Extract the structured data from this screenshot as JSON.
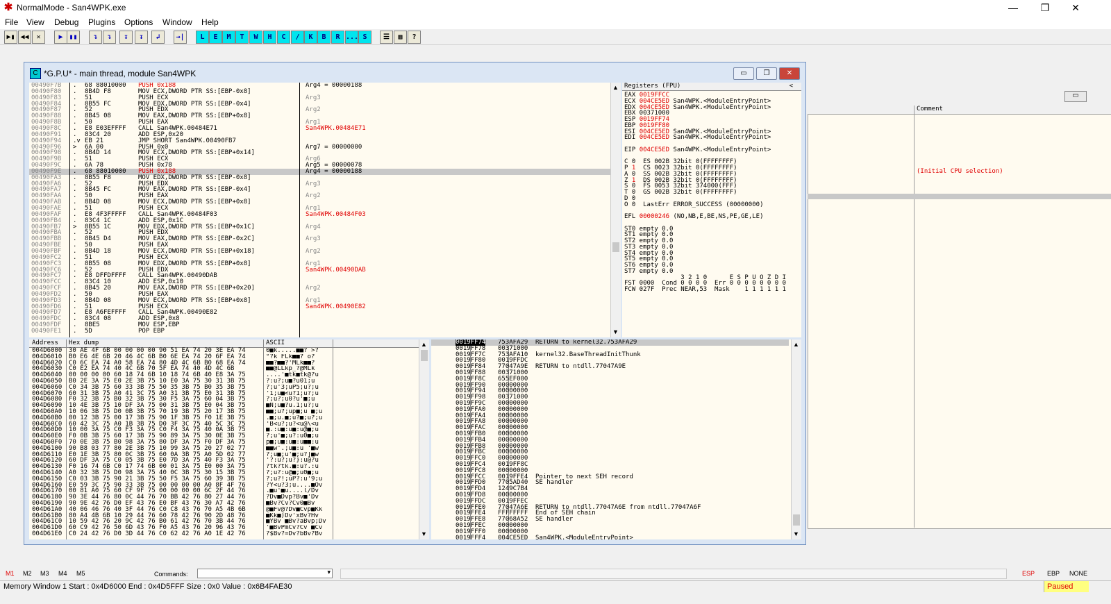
{
  "window": {
    "title": "NormalMode - San4WPK.exe"
  },
  "menu": [
    "File",
    "View",
    "Debug",
    "Plugins",
    "Options",
    "Window",
    "Help"
  ],
  "toolbar": {
    "buttons": [
      "▶▮",
      "◀◀",
      "✕",
      "▶",
      "▮▮",
      "↴",
      "↴",
      "↧",
      "↧",
      "↲",
      "→|",
      "L",
      "E",
      "M",
      "T",
      "W",
      "H",
      "C",
      "/",
      "K",
      "B",
      "R",
      "...",
      "S",
      "☰",
      "▦",
      "?"
    ]
  },
  "cpu": {
    "title": "*G.P.U* - main thread, module San4WPK",
    "icon_letter": "C",
    "disasm": [
      {
        "addr": "00490F7B",
        "dot": ".",
        "hex": "68 88010000",
        "asm": "PUSH 0x188",
        "red": true
      },
      {
        "addr": "00490F80",
        "dot": ".",
        "hex": "8B4D F8",
        "asm": "MOV ECX,DWORD PTR SS:[EBP-0x8]"
      },
      {
        "addr": "00490F83",
        "dot": ".",
        "hex": "51",
        "asm": "PUSH ECX"
      },
      {
        "addr": "00490F84",
        "dot": ".",
        "hex": "8B55 FC",
        "asm": "MOV EDX,DWORD PTR SS:[EBP-0x4]"
      },
      {
        "addr": "00490F87",
        "dot": ".",
        "hex": "52",
        "asm": "PUSH EDX"
      },
      {
        "addr": "00490F88",
        "dot": ".",
        "hex": "8B45 08",
        "asm": "MOV EAX,DWORD PTR SS:[EBP+0x8]"
      },
      {
        "addr": "00490F8B",
        "dot": ".",
        "hex": "50",
        "asm": "PUSH EAX"
      },
      {
        "addr": "00490F8C",
        "dot": ".",
        "hex": "E8 E03EFFFF",
        "asm": "CALL San4WPK.00484E71"
      },
      {
        "addr": "00490F91",
        "dot": ".",
        "hex": "83C4 20",
        "asm": "ADD ESP,0x20"
      },
      {
        "addr": "00490F94",
        "dot": ".v",
        "hex": "EB 21",
        "asm": "JMP SHORT San4WPK.00490FB7"
      },
      {
        "addr": "00490F96",
        "dot": ">",
        "hex": "6A 00",
        "asm": "PUSH 0x0"
      },
      {
        "addr": "00490F98",
        "dot": ".",
        "hex": "8B4D 14",
        "asm": "MOV ECX,DWORD PTR SS:[EBP+0x14]"
      },
      {
        "addr": "00490F9B",
        "dot": ".",
        "hex": "51",
        "asm": "PUSH ECX"
      },
      {
        "addr": "00490F9C",
        "dot": ".",
        "hex": "6A 78",
        "asm": "PUSH 0x78"
      },
      {
        "addr": "00490F9E",
        "dot": ".",
        "hex": "68 88010000",
        "asm": "PUSH 0x188",
        "red": true,
        "sel": true
      },
      {
        "addr": "00490FA3",
        "dot": ".",
        "hex": "8B55 F8",
        "asm": "MOV EDX,DWORD PTR SS:[EBP-0x8]"
      },
      {
        "addr": "00490FA6",
        "dot": ".",
        "hex": "52",
        "asm": "PUSH EDX"
      },
      {
        "addr": "00490FA7",
        "dot": ".",
        "hex": "8B45 FC",
        "asm": "MOV EAX,DWORD PTR SS:[EBP-0x4]"
      },
      {
        "addr": "00490FAA",
        "dot": ".",
        "hex": "50",
        "asm": "PUSH EAX"
      },
      {
        "addr": "00490FAB",
        "dot": ".",
        "hex": "8B4D 08",
        "asm": "MOV ECX,DWORD PTR SS:[EBP+0x8]"
      },
      {
        "addr": "00490FAE",
        "dot": ".",
        "hex": "51",
        "asm": "PUSH ECX"
      },
      {
        "addr": "00490FAF",
        "dot": ".",
        "hex": "E8 4F3FFFFF",
        "asm": "CALL San4WPK.00484F03"
      },
      {
        "addr": "00490FB4",
        "dot": ".",
        "hex": "83C4 1C",
        "asm": "ADD ESP,0x1C"
      },
      {
        "addr": "00490FB7",
        "dot": ">",
        "hex": "8B55 1C",
        "asm": "MOV EDX,DWORD PTR SS:[EBP+0x1C]"
      },
      {
        "addr": "00490FBA",
        "dot": ".",
        "hex": "52",
        "asm": "PUSH EDX"
      },
      {
        "addr": "00490FBB",
        "dot": ".",
        "hex": "8B45 D4",
        "asm": "MOV EAX,DWORD PTR SS:[EBP-0x2C]"
      },
      {
        "addr": "00490FBE",
        "dot": ".",
        "hex": "50",
        "asm": "PUSH EAX"
      },
      {
        "addr": "00490FBF",
        "dot": ".",
        "hex": "8B4D 18",
        "asm": "MOV ECX,DWORD PTR SS:[EBP+0x18]"
      },
      {
        "addr": "00490FC2",
        "dot": ".",
        "hex": "51",
        "asm": "PUSH ECX"
      },
      {
        "addr": "00490FC3",
        "dot": ".",
        "hex": "8B55 08",
        "asm": "MOV EDX,DWORD PTR SS:[EBP+0x8]"
      },
      {
        "addr": "00490FC6",
        "dot": ".",
        "hex": "52",
        "asm": "PUSH EDX"
      },
      {
        "addr": "00490FC7",
        "dot": ".",
        "hex": "E8 DFFDFFFF",
        "asm": "CALL San4WPK.00490DAB"
      },
      {
        "addr": "00490FCC",
        "dot": ".",
        "hex": "83C4 10",
        "asm": "ADD ESP,0x10"
      },
      {
        "addr": "00490FCF",
        "dot": ".",
        "hex": "8B45 20",
        "asm": "MOV EAX,DWORD PTR SS:[EBP+0x20]"
      },
      {
        "addr": "00490FD2",
        "dot": ".",
        "hex": "50",
        "asm": "PUSH EAX"
      },
      {
        "addr": "00490FD3",
        "dot": ".",
        "hex": "8B4D 08",
        "asm": "MOV ECX,DWORD PTR SS:[EBP+0x8]"
      },
      {
        "addr": "00490FD6",
        "dot": ".",
        "hex": "51",
        "asm": "PUSH ECX"
      },
      {
        "addr": "00490FD7",
        "dot": ".",
        "hex": "E8 A6FEFFFF",
        "asm": "CALL San4WPK.00490E82"
      },
      {
        "addr": "00490FDC",
        "dot": ".",
        "hex": "83C4 08",
        "asm": "ADD ESP,0x8"
      },
      {
        "addr": "00490FDF",
        "dot": ".",
        "hex": "8BE5",
        "asm": "MOV ESP,EBP"
      },
      {
        "addr": "00490FE1",
        "dot": ".",
        "hex": "5D",
        "asm": "POP EBP"
      }
    ],
    "comments": [
      "Arg4 = 00000188",
      "",
      "Arg3",
      "",
      "Arg2",
      "",
      "Arg1",
      "San4WPK.00484E71",
      "",
      "",
      "Arg7 = 00000000",
      "",
      "Arg6",
      "Arg5 = 00000078",
      "Arg4 = 00000188",
      "",
      "Arg3",
      "",
      "Arg2",
      "",
      "Arg1",
      "San4WPK.00484F03",
      "",
      "Arg4",
      "",
      "Arg3",
      "",
      "Arg2",
      "",
      "Arg1",
      "San4WPK.00490DAB",
      "",
      "",
      "Arg2",
      "",
      "Arg1",
      "San4WPK.00490E82",
      "",
      "",
      "",
      ""
    ],
    "registers": {
      "header": "Registers (FPU)",
      "lines": [
        {
          "t": "EAX ",
          "v": "0019FFCC",
          "c": ""
        },
        {
          "t": "ECX ",
          "v": "004CE5ED",
          "c": " San4WPK.<ModuleEntryPoint>"
        },
        {
          "t": "EDX ",
          "v": "004CE5ED",
          "c": " San4WPK.<ModuleEntryPoint>"
        },
        {
          "t": "EBX 00371000",
          "v": "",
          "c": ""
        },
        {
          "t": "ESP ",
          "v": "0019FF74",
          "c": ""
        },
        {
          "t": "EBP ",
          "v": "0019FF80",
          "c": ""
        },
        {
          "t": "ESI ",
          "v": "004CE5ED",
          "c": " San4WPK.<ModuleEntryPoint>"
        },
        {
          "t": "EDI ",
          "v": "004CE5ED",
          "c": " San4WPK.<ModuleEntryPoint>"
        },
        {
          "t": "",
          "v": "",
          "c": ""
        },
        {
          "t": "EIP ",
          "v": "004CE5ED",
          "c": " San4WPK.<ModuleEntryPoint>"
        },
        {
          "t": "",
          "v": "",
          "c": ""
        },
        {
          "t": "C 0  ES 002B 32bit 0(FFFFFFFF)",
          "v": "",
          "c": ""
        },
        {
          "t": "P ",
          "v": "1",
          "c": "  CS 0023 32bit 0(FFFFFFFF)"
        },
        {
          "t": "A 0  SS 002B 32bit 0(FFFFFFFF)",
          "v": "",
          "c": ""
        },
        {
          "t": "Z ",
          "v": "1",
          "c": "  DS 002B 32bit 0(FFFFFFFF)"
        },
        {
          "t": "S 0  FS 0053 32bit 374000(FFF)",
          "v": "",
          "c": ""
        },
        {
          "t": "T 0  GS 002B 32bit 0(FFFFFFFF)",
          "v": "",
          "c": ""
        },
        {
          "t": "D 0",
          "v": "",
          "c": ""
        },
        {
          "t": "O 0  LastErr ERROR_SUCCESS (00000000)",
          "v": "",
          "c": ""
        },
        {
          "t": "",
          "v": "",
          "c": ""
        },
        {
          "t": "EFL ",
          "v": "00000246",
          "c": " (NO,NB,E,BE,NS,PE,GE,LE)"
        },
        {
          "t": "",
          "v": "",
          "c": ""
        },
        {
          "t": "ST0 empty 0.0",
          "v": "",
          "c": ""
        },
        {
          "t": "ST1 empty 0.0",
          "v": "",
          "c": ""
        },
        {
          "t": "ST2 empty 0.0",
          "v": "",
          "c": ""
        },
        {
          "t": "ST3 empty 0.0",
          "v": "",
          "c": ""
        },
        {
          "t": "ST4 empty 0.0",
          "v": "",
          "c": ""
        },
        {
          "t": "ST5 empty 0.0",
          "v": "",
          "c": ""
        },
        {
          "t": "ST6 empty 0.0",
          "v": "",
          "c": ""
        },
        {
          "t": "ST7 empty 0.0",
          "v": "",
          "c": ""
        },
        {
          "t": "               3 2 1 0      E S P U O Z D I",
          "v": "",
          "c": ""
        },
        {
          "t": "FST 0000  Cond 0 0 0 0  Err 0 0 0 0 0 0 0 0",
          "v": "",
          "c": ""
        },
        {
          "t": "FCW 027F  Prec NEAR,53  Mask    1 1 1 1 1 1",
          "v": "",
          "c": ""
        }
      ]
    },
    "dump": {
      "col_address": "Address",
      "col_hex": "Hex dump",
      "col_ascii": "ASCII",
      "rows": [
        [
          "004D6000",
          "30 AE 4F 6B 00 00 00 00 90 51 EA 74 20 3E EA 74",
          "0■k.....■■? >?"
        ],
        [
          "004D6010",
          "B0 E6 4E 6B 20 46 4C 6B B0 6E EA 74 20 6F EA 74",
          "°?k FLk■■? o?"
        ],
        [
          "004D6020",
          "C0 6C EA 74 A0 58 EA 74 80 4D 4C 6B B0 68 EA 74",
          "■■?■■?'MLk■■?"
        ],
        [
          "004D6030",
          "C0 E2 EA 74 40 4C 6B 70 5F EA 74 40 4D 4C 6B",
          "■■@LLkp_?@MLk"
        ],
        [
          "004D6040",
          "00 00 00 00 60 18 74 6B 10 18 74 6B 40 E8 3A 75",
          "....'■tk■tk@?u"
        ],
        [
          "004D6050",
          "B0 2E 3A 75 E0 2E 3B 75 10 E0 3A 75 30 31 3B 75",
          "?:u?;u■?u01;u"
        ],
        [
          "004D6060",
          "C0 34 3B 75 60 33 3B 75 50 35 3B 75 B0 35 3B 75",
          "?;u'3;uP5;u?;u"
        ],
        [
          "004D6070",
          "60 31 3B 75 A0 41 3C 75 A0 31 3B 75 E0 31 3B 75",
          "'1;u■<u?1;u?;u"
        ],
        [
          "004D6080",
          "F0 32 3B 75 B0 32 3B 75 30 F5 3A 75 60 04 3B 75",
          "?;u?;u0?u'■;u"
        ],
        [
          "004D6090",
          "10 4E 3B 75 10 DF 3A 75 00 31 3B 75 E0 04 3B 75",
          "■N;u■?u.1;u?;u"
        ],
        [
          "004D60A0",
          "10 06 3B 75 D0 0B 3B 75 70 19 3B 75 20 17 3B 75",
          "■■;u?;up■;u ■;u"
        ],
        [
          "004D60B0",
          "00 12 3B 75 00 17 3B 75 90 1F 3B 75 F0 1E 3B 75",
          ".■;u.■;u?■;u?;u"
        ],
        [
          "004D60C0",
          "60 42 3C 75 A0 1B 3B 75 D0 3F 3C 75 40 5C 3C 75",
          "'B<u?;u?<u@\\<u"
        ],
        [
          "004D60D0",
          "10 00 3A 75 C0 F3 3A 75 C0 F4 3A 75 40 0A 3B 75",
          "■.:u■:u■:u@■;u"
        ],
        [
          "004D60E0",
          "F0 0B 3B 75 60 17 3B 75 90 89 3A 75 30 0E 3B 75",
          "?;u'■;u?:u0■;u"
        ],
        [
          "004D60F0",
          "70 0E 3B 75 B0 98 3A 75 80 DF 3A 75 F0 DF 3A 75",
          "p■;u■:u■:u■■:u"
        ],
        [
          "004D6100",
          "90 B8 03 77 80 2E 3B 75 10 99 3A 75 20 27 02 77",
          "■■w'.;u■:u '■w"
        ],
        [
          "004D6110",
          "E0 1E 3B 75 80 0C 3B 75 60 0A 3B 75 A0 5D 02 77",
          "?;u■;u'■;u?]■w"
        ],
        [
          "004D6120",
          "60 DF 3A 75 C0 05 3B 75 E0 7D 3A 75 40 F3 3A 75",
          "'?:u?;u?}:u@?u"
        ],
        [
          "004D6130",
          "F0 16 74 6B C0 17 74 6B 00 01 3A 75 E0 00 3A 75",
          "?tk?tk.■:u?.:u"
        ],
        [
          "004D6140",
          "A0 32 3B 75 D0 98 3A 75 40 0C 3B 75 30 15 3B 75",
          "?;u?:u@■;u0■;u"
        ],
        [
          "004D6150",
          "C0 03 3B 75 90 21 3B 75 50 F5 3A 75 60 39 3B 75",
          "?;u?!;uP?:u'9;u"
        ],
        [
          "004D6160",
          "E0 59 3C 75 90 33 3B 75 00 00 00 00 A0 8F 4F 76",
          "?Y<u?3;u....■Ov"
        ],
        [
          "004D6170",
          "00 81 A0 75 60 CF 9F 75 00 00 00 00 6C 2F 44 76",
          ".■u'■u....l/Dv"
        ],
        [
          "004D6180",
          "90 3E 44 76 80 0C 44 76 70 BB 42 76 80 27 44 76",
          "?Dv■Dvp?Bv■'Dv"
        ],
        [
          "004D6190",
          "90 9E 42 76 D0 EF 43 76 E0 BF 43 76 30 A7 42 76",
          "■Bv?Cv?Cv0■Bv"
        ],
        [
          "004D61A0",
          "40 06 46 76 40 3F 44 76 C0 C8 43 76 70 A5 4B 6B",
          "@■Fv@?Dv■Cvp■Kk"
        ],
        [
          "004D61B0",
          "80 A4 4B 6B 10 29 44 76 60 78 42 76 90 2D 48 76",
          "■Kk■)Dv'xBv?Hv"
        ],
        [
          "004D61C0",
          "10 59 42 76 20 9C 42 76 B0 61 42 76 70 3B 44 76",
          "■YBv ■Bv?aBvp;Dv"
        ],
        [
          "004D61D0",
          "60 C9 42 76 50 6D 43 76 F0 A5 43 76 20 96 43 76",
          "'■BvPmCv?Cv ■Cv"
        ],
        [
          "004D61E0",
          "C0 24 42 76 D0 3D 44 76 C0 62 42 76 A0 1E 42 76",
          "?$Bv?=Dv?bBv?Bv"
        ]
      ]
    },
    "stack": [
      {
        "a": "0019FF74",
        "v": "753AFA29",
        "c": "RETURN to kernel32.753AFA29",
        "sel": true
      },
      {
        "a": "0019FF78",
        "v": "00371000",
        "c": ""
      },
      {
        "a": "0019FF7C",
        "v": "753AFA10",
        "c": "kernel32.BaseThreadInitThunk"
      },
      {
        "a": "0019FF80",
        "v": "0019FFDC",
        "c": ""
      },
      {
        "a": "0019FF84",
        "v": "77047A9E",
        "c": "RETURN to ntdll.77047A9E"
      },
      {
        "a": "0019FF88",
        "v": "00371000",
        "c": ""
      },
      {
        "a": "0019FF8C",
        "v": "655EF000",
        "c": ""
      },
      {
        "a": "0019FF90",
        "v": "00000000",
        "c": ""
      },
      {
        "a": "0019FF94",
        "v": "00000000",
        "c": ""
      },
      {
        "a": "0019FF98",
        "v": "00371000",
        "c": ""
      },
      {
        "a": "0019FF9C",
        "v": "00000000",
        "c": ""
      },
      {
        "a": "0019FFA0",
        "v": "00000000",
        "c": ""
      },
      {
        "a": "0019FFA4",
        "v": "00000000",
        "c": ""
      },
      {
        "a": "0019FFA8",
        "v": "00000000",
        "c": ""
      },
      {
        "a": "0019FFAC",
        "v": "00000000",
        "c": ""
      },
      {
        "a": "0019FFB0",
        "v": "00000000",
        "c": ""
      },
      {
        "a": "0019FFB4",
        "v": "00000000",
        "c": ""
      },
      {
        "a": "0019FFB8",
        "v": "00000000",
        "c": ""
      },
      {
        "a": "0019FFBC",
        "v": "00000000",
        "c": ""
      },
      {
        "a": "0019FFC0",
        "v": "00000000",
        "c": ""
      },
      {
        "a": "0019FFC4",
        "v": "0019FF8C",
        "c": ""
      },
      {
        "a": "0019FFC8",
        "v": "00000000",
        "c": ""
      },
      {
        "a": "0019FFCC",
        "v": "0019FFE4",
        "c": "Pointer to next SEH record"
      },
      {
        "a": "0019FFD0",
        "v": "7705AD40",
        "c": "SE handler"
      },
      {
        "a": "0019FFD4",
        "v": "1249C7B4",
        "c": ""
      },
      {
        "a": "0019FFD8",
        "v": "00000000",
        "c": ""
      },
      {
        "a": "0019FFDC",
        "v": "0019FFEC",
        "c": ""
      },
      {
        "a": "0019FFE0",
        "v": "77047A6E",
        "c": "RETURN to ntdll.77047A6E from ntdll.77047A6F"
      },
      {
        "a": "0019FFE4",
        "v": "FFFFFFFF",
        "c": "End of SEH chain"
      },
      {
        "a": "0019FFE8",
        "v": "77068A52",
        "c": "SE handler"
      },
      {
        "a": "0019FFEC",
        "v": "00000000",
        "c": ""
      },
      {
        "a": "0019FFF0",
        "v": "00000000",
        "c": ""
      },
      {
        "a": "0019FFF4",
        "v": "004CE5ED",
        "c": "San4WPK.<ModuleEntryPoint>"
      }
    ]
  },
  "background_pane": {
    "comment_header": "Comment",
    "comment_text": "(Initial CPU selection)"
  },
  "command_bar": {
    "tabs": [
      "M1",
      "M2",
      "M3",
      "M4",
      "M5"
    ],
    "commands_label": "Commands:",
    "reg_tabs": [
      "ESP",
      "EBP",
      "NONE"
    ]
  },
  "status": {
    "text": "Memory Window 1  Start : 0x4D6000  End : 0x4D5FFF  Size : 0x0 Value : 0x6B4FAE30",
    "state": "Paused"
  },
  "colors": {
    "accent_red": "#e00000",
    "paused_bg": "#ffff80",
    "cyan_button": "#00e5ee"
  }
}
